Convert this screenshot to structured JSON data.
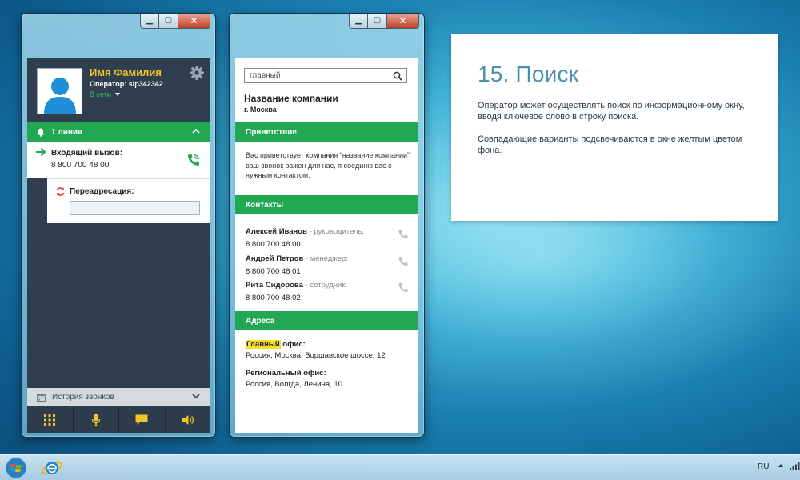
{
  "phone": {
    "user_name": "Имя Фамилия",
    "operator": "Оператор: sip342342",
    "status": "В сети",
    "line_label": "1 линия",
    "incoming_title": "Входящий вызов:",
    "incoming_number": "8 800 700 48 00",
    "redirect_label": "Переадресация:",
    "redirect_value": "",
    "history_label": "История звонков"
  },
  "info": {
    "search_value": "главный",
    "company_name": "Название компании",
    "company_city": "г. Москва",
    "greeting_header": "Приветствие",
    "greeting_text": "Вас приветствует компания  “название компании” ваш звонок важен для нас, я соединю вас с нужным контактом.",
    "contacts_header": "Контакты",
    "contacts": [
      {
        "name": "Алексей Иванов",
        "role": " - руководитель:",
        "phone": "8 800 700 48 00"
      },
      {
        "name": "Андрей Петров",
        "role": " - менеджер:",
        "phone": "8 800 700 48 01"
      },
      {
        "name": "Рита Сидорова",
        "role": " - сотрудник:",
        "phone": "8 800 700 48 02"
      }
    ],
    "addresses_header": "Адреса",
    "addresses": [
      {
        "title_highlight": "Главный",
        "title_rest": " офис:",
        "address": "Россия, Москва, Воршавское шоссе, 12"
      },
      {
        "title": "Региональный офис:",
        "address": "Россия, Волгда, Ленина, 10"
      }
    ]
  },
  "slide": {
    "title": "15. Поиск",
    "paragraph1": "Оператор может осуществлять поиск по информационному окну, вводя ключевое слово в строку поиска.",
    "paragraph2": "Совпадающие варианты подсвечиваются в окне желтым цветом фона."
  },
  "taskbar": {
    "language": "RU"
  },
  "colors": {
    "green": "#22a852",
    "dark_panel": "#2f3f4f",
    "name_yellow": "#f3c62a",
    "highlight_yellow": "#f7e02a",
    "slide_title_blue": "#4b8fb0"
  },
  "icons": [
    "user-avatar-icon",
    "gear-icon",
    "bell-icon",
    "chevron-up-icon",
    "arrow-right-icon",
    "phone-answer-icon",
    "refresh-icon",
    "calendar-icon",
    "chevron-down-icon",
    "keypad-icon",
    "microphone-icon",
    "chat-icon",
    "speaker-icon",
    "search-icon",
    "phone-icon",
    "windows-start-icon",
    "internet-explorer-icon",
    "tray-arrow-icon",
    "network-icon"
  ]
}
